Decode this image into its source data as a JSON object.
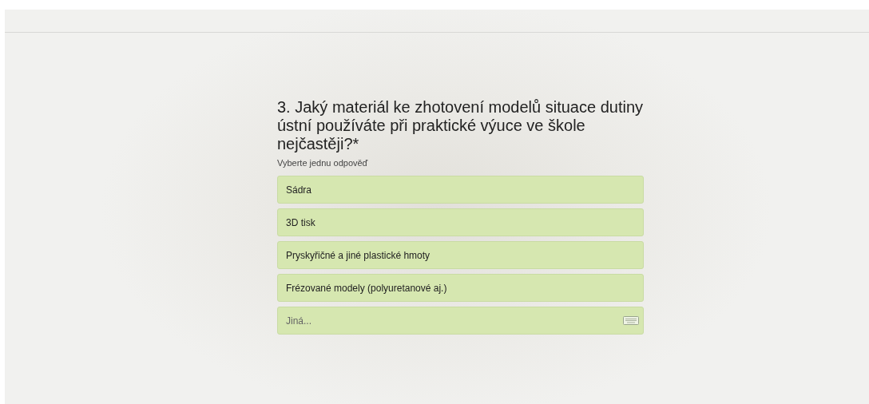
{
  "question": {
    "title": "3. Jaký materiál ke zhotovení modelů situace dutiny ústní používáte při praktické výuce ve škole nejčastěji?*",
    "hint": "Vyberte jednu odpověď"
  },
  "options": [
    {
      "kind": "choice",
      "label": "Sádra"
    },
    {
      "kind": "choice",
      "label": "3D tisk"
    },
    {
      "kind": "choice",
      "label": "Pryskyřičné a jiné plastické hmoty"
    },
    {
      "kind": "choice",
      "label": "Frézované modely (polyuretanové aj.)"
    },
    {
      "kind": "other",
      "placeholder": "Jiná..."
    }
  ]
}
